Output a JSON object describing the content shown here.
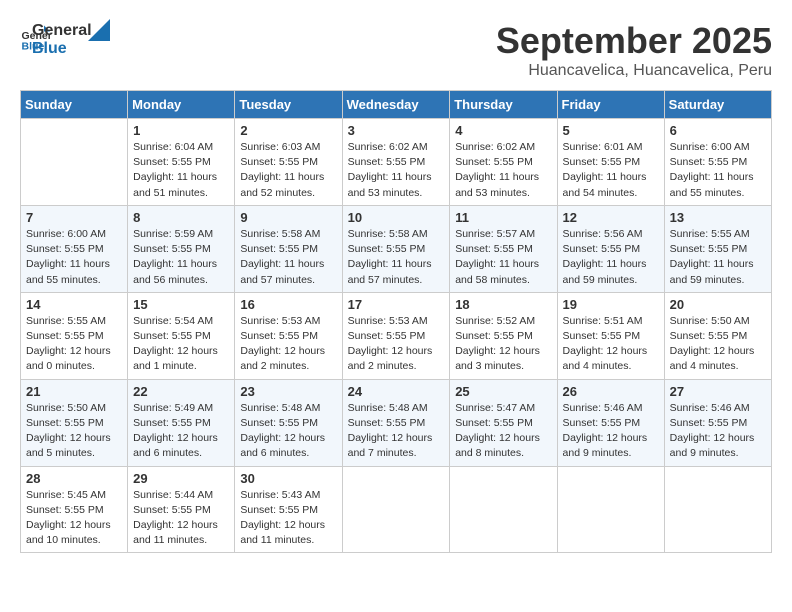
{
  "logo": {
    "general": "General",
    "blue": "Blue"
  },
  "title": "September 2025",
  "location": "Huancavelica, Huancavelica, Peru",
  "days_of_week": [
    "Sunday",
    "Monday",
    "Tuesday",
    "Wednesday",
    "Thursday",
    "Friday",
    "Saturday"
  ],
  "weeks": [
    [
      {
        "day": "",
        "info": ""
      },
      {
        "day": "1",
        "info": "Sunrise: 6:04 AM\nSunset: 5:55 PM\nDaylight: 11 hours\nand 51 minutes."
      },
      {
        "day": "2",
        "info": "Sunrise: 6:03 AM\nSunset: 5:55 PM\nDaylight: 11 hours\nand 52 minutes."
      },
      {
        "day": "3",
        "info": "Sunrise: 6:02 AM\nSunset: 5:55 PM\nDaylight: 11 hours\nand 53 minutes."
      },
      {
        "day": "4",
        "info": "Sunrise: 6:02 AM\nSunset: 5:55 PM\nDaylight: 11 hours\nand 53 minutes."
      },
      {
        "day": "5",
        "info": "Sunrise: 6:01 AM\nSunset: 5:55 PM\nDaylight: 11 hours\nand 54 minutes."
      },
      {
        "day": "6",
        "info": "Sunrise: 6:00 AM\nSunset: 5:55 PM\nDaylight: 11 hours\nand 55 minutes."
      }
    ],
    [
      {
        "day": "7",
        "info": "Sunrise: 6:00 AM\nSunset: 5:55 PM\nDaylight: 11 hours\nand 55 minutes."
      },
      {
        "day": "8",
        "info": "Sunrise: 5:59 AM\nSunset: 5:55 PM\nDaylight: 11 hours\nand 56 minutes."
      },
      {
        "day": "9",
        "info": "Sunrise: 5:58 AM\nSunset: 5:55 PM\nDaylight: 11 hours\nand 57 minutes."
      },
      {
        "day": "10",
        "info": "Sunrise: 5:58 AM\nSunset: 5:55 PM\nDaylight: 11 hours\nand 57 minutes."
      },
      {
        "day": "11",
        "info": "Sunrise: 5:57 AM\nSunset: 5:55 PM\nDaylight: 11 hours\nand 58 minutes."
      },
      {
        "day": "12",
        "info": "Sunrise: 5:56 AM\nSunset: 5:55 PM\nDaylight: 11 hours\nand 59 minutes."
      },
      {
        "day": "13",
        "info": "Sunrise: 5:55 AM\nSunset: 5:55 PM\nDaylight: 11 hours\nand 59 minutes."
      }
    ],
    [
      {
        "day": "14",
        "info": "Sunrise: 5:55 AM\nSunset: 5:55 PM\nDaylight: 12 hours\nand 0 minutes."
      },
      {
        "day": "15",
        "info": "Sunrise: 5:54 AM\nSunset: 5:55 PM\nDaylight: 12 hours\nand 1 minute."
      },
      {
        "day": "16",
        "info": "Sunrise: 5:53 AM\nSunset: 5:55 PM\nDaylight: 12 hours\nand 2 minutes."
      },
      {
        "day": "17",
        "info": "Sunrise: 5:53 AM\nSunset: 5:55 PM\nDaylight: 12 hours\nand 2 minutes."
      },
      {
        "day": "18",
        "info": "Sunrise: 5:52 AM\nSunset: 5:55 PM\nDaylight: 12 hours\nand 3 minutes."
      },
      {
        "day": "19",
        "info": "Sunrise: 5:51 AM\nSunset: 5:55 PM\nDaylight: 12 hours\nand 4 minutes."
      },
      {
        "day": "20",
        "info": "Sunrise: 5:50 AM\nSunset: 5:55 PM\nDaylight: 12 hours\nand 4 minutes."
      }
    ],
    [
      {
        "day": "21",
        "info": "Sunrise: 5:50 AM\nSunset: 5:55 PM\nDaylight: 12 hours\nand 5 minutes."
      },
      {
        "day": "22",
        "info": "Sunrise: 5:49 AM\nSunset: 5:55 PM\nDaylight: 12 hours\nand 6 minutes."
      },
      {
        "day": "23",
        "info": "Sunrise: 5:48 AM\nSunset: 5:55 PM\nDaylight: 12 hours\nand 6 minutes."
      },
      {
        "day": "24",
        "info": "Sunrise: 5:48 AM\nSunset: 5:55 PM\nDaylight: 12 hours\nand 7 minutes."
      },
      {
        "day": "25",
        "info": "Sunrise: 5:47 AM\nSunset: 5:55 PM\nDaylight: 12 hours\nand 8 minutes."
      },
      {
        "day": "26",
        "info": "Sunrise: 5:46 AM\nSunset: 5:55 PM\nDaylight: 12 hours\nand 9 minutes."
      },
      {
        "day": "27",
        "info": "Sunrise: 5:46 AM\nSunset: 5:55 PM\nDaylight: 12 hours\nand 9 minutes."
      }
    ],
    [
      {
        "day": "28",
        "info": "Sunrise: 5:45 AM\nSunset: 5:55 PM\nDaylight: 12 hours\nand 10 minutes."
      },
      {
        "day": "29",
        "info": "Sunrise: 5:44 AM\nSunset: 5:55 PM\nDaylight: 12 hours\nand 11 minutes."
      },
      {
        "day": "30",
        "info": "Sunrise: 5:43 AM\nSunset: 5:55 PM\nDaylight: 12 hours\nand 11 minutes."
      },
      {
        "day": "",
        "info": ""
      },
      {
        "day": "",
        "info": ""
      },
      {
        "day": "",
        "info": ""
      },
      {
        "day": "",
        "info": ""
      }
    ]
  ]
}
